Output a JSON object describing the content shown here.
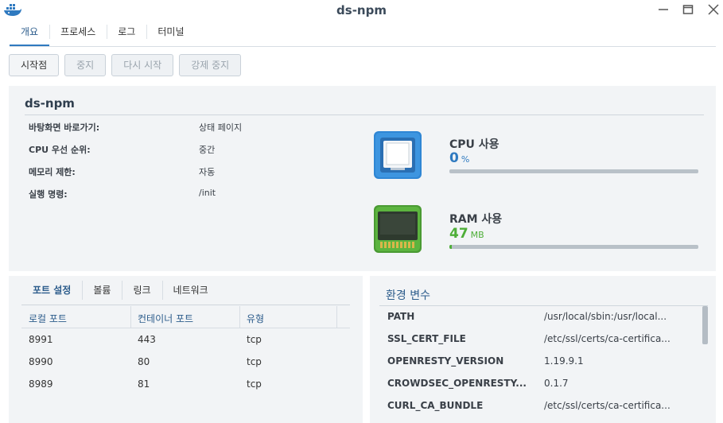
{
  "window": {
    "title": "ds-npm",
    "icon": "docker-whale-icon"
  },
  "main_tabs": [
    {
      "label": "개요",
      "active": true
    },
    {
      "label": "프로세스",
      "active": false
    },
    {
      "label": "로그",
      "active": false
    },
    {
      "label": "터미널",
      "active": false
    }
  ],
  "actions": {
    "start": "시작점",
    "stop": "중지",
    "restart": "다시 시작",
    "force_stop": "강제 중지"
  },
  "overview": {
    "name": "ds-npm",
    "details": [
      {
        "label": "바탕화면 바로가기:",
        "value": "상태 페이지"
      },
      {
        "label": "CPU 우선 순위:",
        "value": "중간"
      },
      {
        "label": "메모리 제한:",
        "value": "자동"
      },
      {
        "label": "실행 명령:",
        "value": "/init"
      }
    ],
    "cpu": {
      "title": "CPU 사용",
      "value": "0",
      "unit": "%",
      "fraction": 0.0,
      "color": "#2f7ac0"
    },
    "ram": {
      "title": "RAM 사용",
      "value": "47",
      "unit": "MB",
      "fraction": 0.01,
      "color": "#4eae38"
    }
  },
  "ports": {
    "tabs": [
      "포트 설정",
      "볼륨",
      "링크",
      "네트워크"
    ],
    "headers": [
      "로컬 포트",
      "컨테이너 포트",
      "유형"
    ],
    "rows": [
      [
        "8991",
        "443",
        "tcp"
      ],
      [
        "8990",
        "80",
        "tcp"
      ],
      [
        "8989",
        "81",
        "tcp"
      ]
    ]
  },
  "env": {
    "title": "환경 변수",
    "rows": [
      {
        "key": "PATH",
        "value": "/usr/local/sbin:/usr/local..."
      },
      {
        "key": "SSL_CERT_FILE",
        "value": "/etc/ssl/certs/ca-certifica..."
      },
      {
        "key": "OPENRESTY_VERSION",
        "value": "1.19.9.1"
      },
      {
        "key": "CROWDSEC_OPENRESTY...",
        "value": "0.1.7"
      },
      {
        "key": "CURL_CA_BUNDLE",
        "value": "/etc/ssl/certs/ca-certifica..."
      }
    ]
  }
}
